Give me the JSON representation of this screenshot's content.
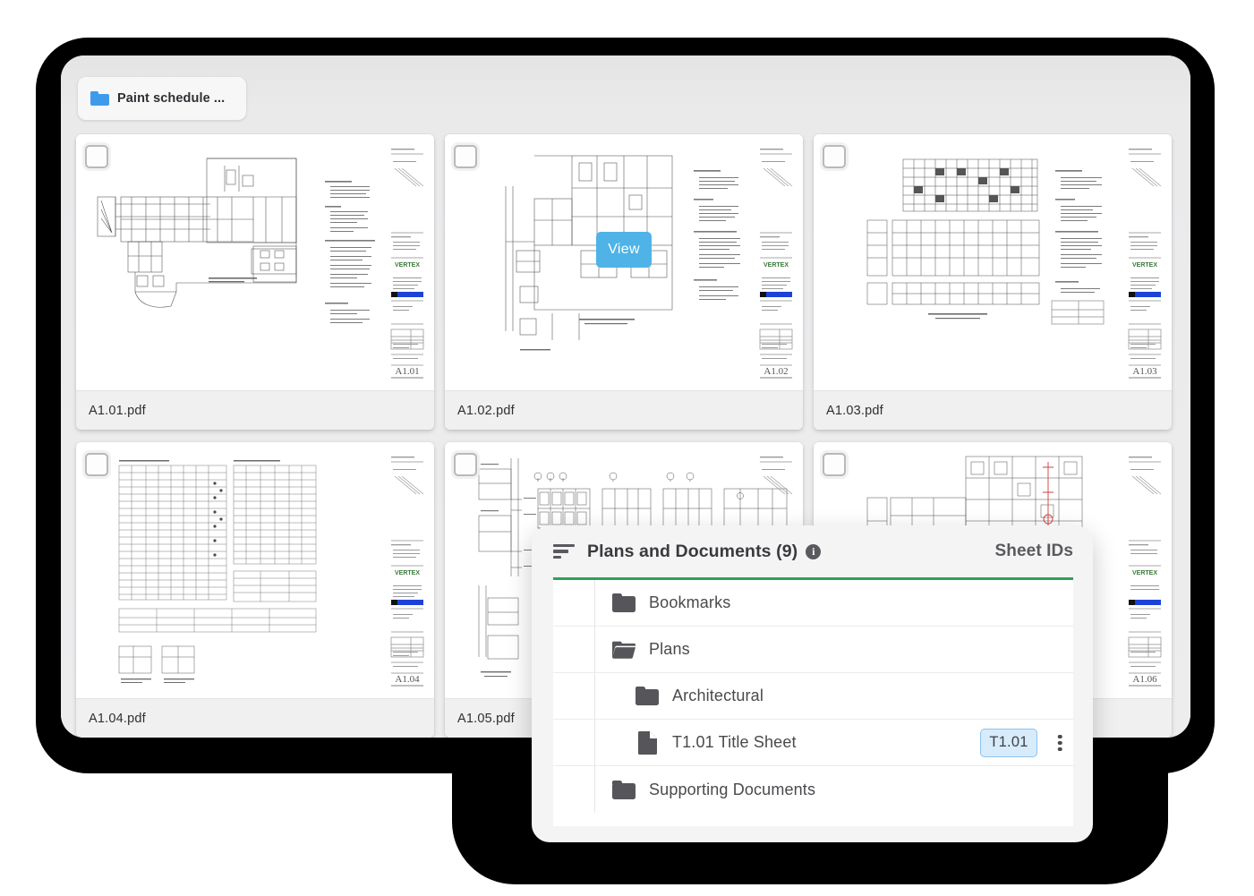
{
  "breadcrumb": {
    "icon": "folder-icon",
    "label": "Paint schedule ..."
  },
  "grid": {
    "cards": [
      {
        "filename": "A1.01.pdf",
        "checkbox_checked": false,
        "sheet_type": "floor-plan",
        "hovered": false,
        "view_label": ""
      },
      {
        "filename": "A1.02.pdf",
        "checkbox_checked": false,
        "sheet_type": "floor-plan-partial",
        "hovered": true,
        "view_label": "View"
      },
      {
        "filename": "A1.03.pdf",
        "checkbox_checked": false,
        "sheet_type": "reflected-ceiling-plan",
        "hovered": false,
        "view_label": ""
      },
      {
        "filename": "A1.04.pdf",
        "checkbox_checked": false,
        "sheet_type": "schedule-table",
        "hovered": false,
        "view_label": ""
      },
      {
        "filename": "A1.05.pdf",
        "checkbox_checked": false,
        "sheet_type": "elevations",
        "hovered": false,
        "view_label": ""
      },
      {
        "filename": "",
        "checkbox_checked": false,
        "sheet_type": "enlarged-plan",
        "hovered": false,
        "view_label": ""
      }
    ]
  },
  "panel": {
    "sort_icon": "sort-lines-icon",
    "title": "Plans and Documents (9)",
    "info_icon": "info-icon",
    "info_glyph": "i",
    "column_header_right": "Sheet IDs",
    "accent_color": "#2fa05a",
    "rows": [
      {
        "label": "Bookmarks",
        "icon": "folder-closed-icon",
        "depth": 0,
        "sheet_id": "",
        "has_menu": false
      },
      {
        "label": "Plans",
        "icon": "folder-open-icon",
        "depth": 0,
        "sheet_id": "",
        "has_menu": false
      },
      {
        "label": "Architectural",
        "icon": "folder-closed-icon",
        "depth": 1,
        "sheet_id": "",
        "has_menu": false
      },
      {
        "label": "T1.01 Title Sheet",
        "icon": "document-icon",
        "depth": 1,
        "sheet_id": "T1.01",
        "has_menu": true
      },
      {
        "label": "Supporting Documents",
        "icon": "folder-closed-icon",
        "depth": 0,
        "sheet_id": "",
        "has_menu": false
      }
    ],
    "menu_icon": "kebab-menu-icon"
  },
  "colors": {
    "accent_green": "#2fa05a",
    "view_button_blue": "#4fb3e8",
    "badge_blue_bg": "#d7ebfb",
    "badge_blue_border": "#8ec3ec",
    "folder_blue": "#3d9bea",
    "icon_grey": "#55555a",
    "bezel_black": "#000000",
    "screen_grey": "#e9e9ea"
  }
}
